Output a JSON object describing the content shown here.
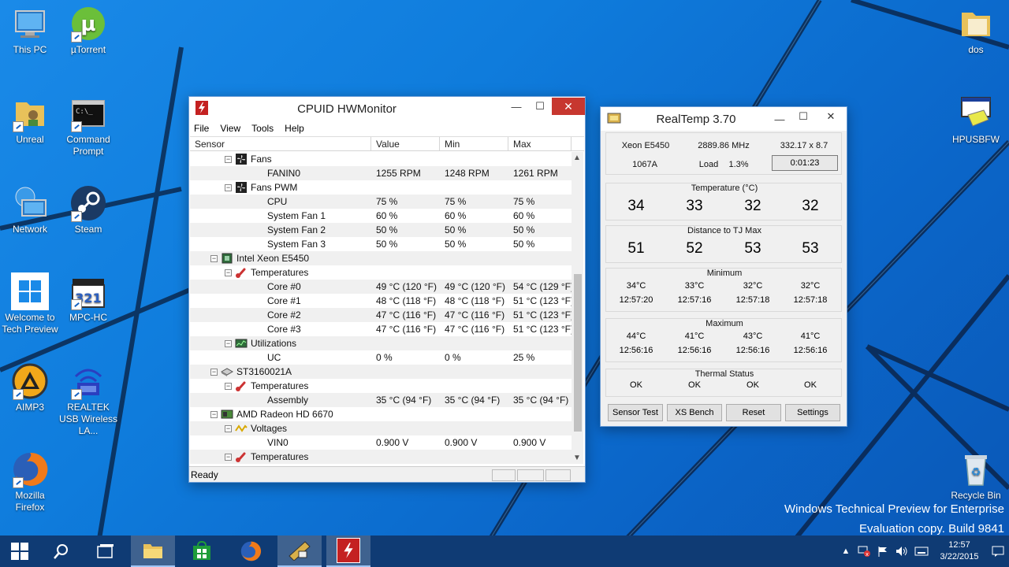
{
  "desktop": {
    "icons_left": [
      {
        "label": "This PC"
      },
      {
        "label": "µTorrent"
      },
      {
        "label": "Unreal"
      },
      {
        "label": "Command Prompt"
      },
      {
        "label": "Network"
      },
      {
        "label": "Steam"
      },
      {
        "label": "Welcome to Tech Preview"
      },
      {
        "label": "MPC-HC"
      },
      {
        "label": "AIMP3"
      },
      {
        "label": "REALTEK USB Wireless LA..."
      },
      {
        "label": "Mozilla Firefox"
      }
    ],
    "icons_right": [
      {
        "label": "dos"
      },
      {
        "label": "HPUSBFW"
      },
      {
        "label": "Recycle Bin"
      }
    ],
    "watermark": {
      "line1": "Windows Technical Preview for Enterprise",
      "line2": "Evaluation copy. Build 9841"
    }
  },
  "hwmonitor": {
    "title": "CPUID HWMonitor",
    "menu": [
      "File",
      "View",
      "Tools",
      "Help"
    ],
    "columns": [
      "Sensor",
      "Value",
      "Min",
      "Max"
    ],
    "rows": [
      {
        "level": 2,
        "toggle": "−",
        "icon": "fan-icon",
        "name": "Fans",
        "value": "",
        "min": "",
        "max": ""
      },
      {
        "level": 3,
        "name": "FANIN0",
        "value": "1255 RPM",
        "min": "1248 RPM",
        "max": "1261 RPM"
      },
      {
        "level": 2,
        "toggle": "−",
        "icon": "fan-icon",
        "name": "Fans PWM",
        "value": "",
        "min": "",
        "max": ""
      },
      {
        "level": 3,
        "name": "CPU",
        "value": "75 %",
        "min": "75 %",
        "max": "75 %"
      },
      {
        "level": 3,
        "name": "System Fan 1",
        "value": "60 %",
        "min": "60 %",
        "max": "60 %"
      },
      {
        "level": 3,
        "name": "System Fan 2",
        "value": "50 %",
        "min": "50 %",
        "max": "50 %"
      },
      {
        "level": 3,
        "name": "System Fan 3",
        "value": "50 %",
        "min": "50 %",
        "max": "50 %"
      },
      {
        "level": 1,
        "toggle": "−",
        "icon": "cpu-icon",
        "name": "Intel Xeon E5450",
        "value": "",
        "min": "",
        "max": ""
      },
      {
        "level": 2,
        "toggle": "−",
        "icon": "thermometer-icon",
        "name": "Temperatures",
        "value": "",
        "min": "",
        "max": ""
      },
      {
        "level": 3,
        "name": "Core #0",
        "value": "49 °C  (120 °F)",
        "min": "49 °C  (120 °F)",
        "max": "54 °C  (129 °F)"
      },
      {
        "level": 3,
        "name": "Core #1",
        "value": "48 °C  (118 °F)",
        "min": "48 °C  (118 °F)",
        "max": "51 °C  (123 °F)"
      },
      {
        "level": 3,
        "name": "Core #2",
        "value": "47 °C  (116 °F)",
        "min": "47 °C  (116 °F)",
        "max": "51 °C  (123 °F)"
      },
      {
        "level": 3,
        "name": "Core #3",
        "value": "47 °C  (116 °F)",
        "min": "47 °C  (116 °F)",
        "max": "51 °C  (123 °F)"
      },
      {
        "level": 2,
        "toggle": "−",
        "icon": "utilization-icon",
        "name": "Utilizations",
        "value": "",
        "min": "",
        "max": ""
      },
      {
        "level": 3,
        "name": "UC",
        "value": "0 %",
        "min": "0 %",
        "max": "25 %"
      },
      {
        "level": 1,
        "toggle": "−",
        "icon": "hdd-icon",
        "name": "ST3160021A",
        "value": "",
        "min": "",
        "max": ""
      },
      {
        "level": 2,
        "toggle": "−",
        "icon": "thermometer-icon",
        "name": "Temperatures",
        "value": "",
        "min": "",
        "max": ""
      },
      {
        "level": 3,
        "name": "Assembly",
        "value": "35 °C  (94 °F)",
        "min": "35 °C  (94 °F)",
        "max": "35 °C  (94 °F)"
      },
      {
        "level": 1,
        "toggle": "−",
        "icon": "gpu-icon",
        "name": "AMD Radeon HD 6670",
        "value": "",
        "min": "",
        "max": ""
      },
      {
        "level": 2,
        "toggle": "−",
        "icon": "voltage-icon",
        "name": "Voltages",
        "value": "",
        "min": "",
        "max": ""
      },
      {
        "level": 3,
        "name": "VIN0",
        "value": "0.900 V",
        "min": "0.900 V",
        "max": "0.900 V"
      },
      {
        "level": 2,
        "toggle": "−",
        "icon": "thermometer-icon",
        "name": "Temperatures",
        "value": "",
        "min": "",
        "max": ""
      }
    ],
    "status": "Ready"
  },
  "realtemp": {
    "title": "RealTemp 3.70",
    "cpu_name": "Xeon E5450",
    "mhz": "2889.86 MHz",
    "multiplier": "332.17 x 8.7",
    "vid": "1067A",
    "load_label": "Load",
    "load_value": "1.3%",
    "timer": "0:01:23",
    "temperature_title": "Temperature (°C)",
    "temperatures": [
      "34",
      "33",
      "32",
      "32"
    ],
    "distance_title": "Distance to TJ Max",
    "distances": [
      "51",
      "52",
      "53",
      "53"
    ],
    "minimum_title": "Minimum",
    "minimum_temps": [
      "34°C",
      "33°C",
      "32°C",
      "32°C"
    ],
    "minimum_times": [
      "12:57:20",
      "12:57:16",
      "12:57:18",
      "12:57:18"
    ],
    "maximum_title": "Maximum",
    "maximum_temps": [
      "44°C",
      "41°C",
      "43°C",
      "41°C"
    ],
    "maximum_times": [
      "12:56:16",
      "12:56:16",
      "12:56:16",
      "12:56:16"
    ],
    "thermal_title": "Thermal Status",
    "thermal_status": [
      "OK",
      "OK",
      "OK",
      "OK"
    ],
    "buttons": [
      "Sensor Test",
      "XS Bench",
      "Reset",
      "Settings"
    ]
  },
  "taskbar": {
    "time": "12:57",
    "date": "3/22/2015"
  }
}
